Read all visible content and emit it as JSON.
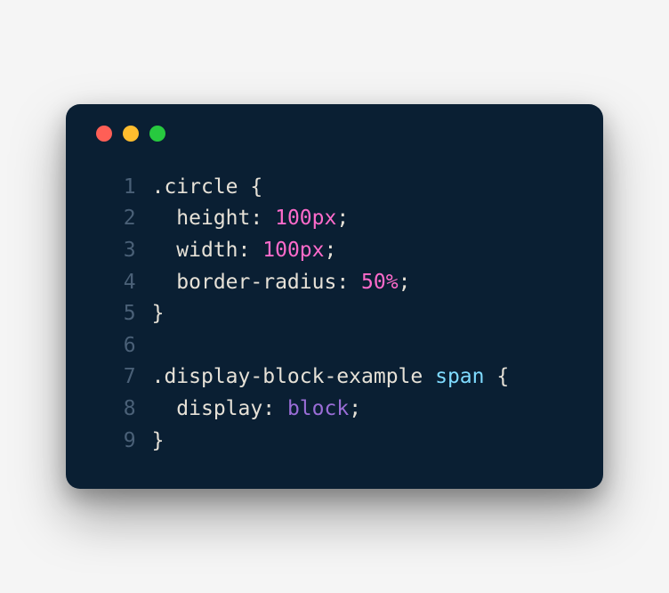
{
  "traffic_lights": {
    "red": "#ff5f56",
    "yellow": "#ffbd2e",
    "green": "#27c93f"
  },
  "code": {
    "lines": [
      {
        "n": "1",
        "tokens": [
          {
            "t": ".circle ",
            "c": "sel"
          },
          {
            "t": "{",
            "c": "punc"
          }
        ]
      },
      {
        "n": "2",
        "tokens": [
          {
            "t": "  ",
            "c": "punc"
          },
          {
            "t": "height",
            "c": "prop"
          },
          {
            "t": ": ",
            "c": "punc"
          },
          {
            "t": "100px",
            "c": "num"
          },
          {
            "t": ";",
            "c": "punc"
          }
        ]
      },
      {
        "n": "3",
        "tokens": [
          {
            "t": "  ",
            "c": "punc"
          },
          {
            "t": "width",
            "c": "prop"
          },
          {
            "t": ": ",
            "c": "punc"
          },
          {
            "t": "100px",
            "c": "num"
          },
          {
            "t": ";",
            "c": "punc"
          }
        ]
      },
      {
        "n": "4",
        "tokens": [
          {
            "t": "  ",
            "c": "punc"
          },
          {
            "t": "border-radius",
            "c": "prop"
          },
          {
            "t": ": ",
            "c": "punc"
          },
          {
            "t": "50%",
            "c": "num"
          },
          {
            "t": ";",
            "c": "punc"
          }
        ]
      },
      {
        "n": "5",
        "tokens": [
          {
            "t": "}",
            "c": "punc"
          }
        ]
      },
      {
        "n": "6",
        "tokens": [
          {
            "t": "",
            "c": "punc"
          }
        ]
      },
      {
        "n": "7",
        "tokens": [
          {
            "t": ".display-block-example ",
            "c": "sel"
          },
          {
            "t": "span ",
            "c": "tag"
          },
          {
            "t": "{",
            "c": "punc"
          }
        ]
      },
      {
        "n": "8",
        "tokens": [
          {
            "t": "  ",
            "c": "punc"
          },
          {
            "t": "display",
            "c": "prop"
          },
          {
            "t": ": ",
            "c": "punc"
          },
          {
            "t": "block",
            "c": "kw"
          },
          {
            "t": ";",
            "c": "punc"
          }
        ]
      },
      {
        "n": "9",
        "tokens": [
          {
            "t": "}",
            "c": "punc"
          }
        ]
      }
    ]
  }
}
